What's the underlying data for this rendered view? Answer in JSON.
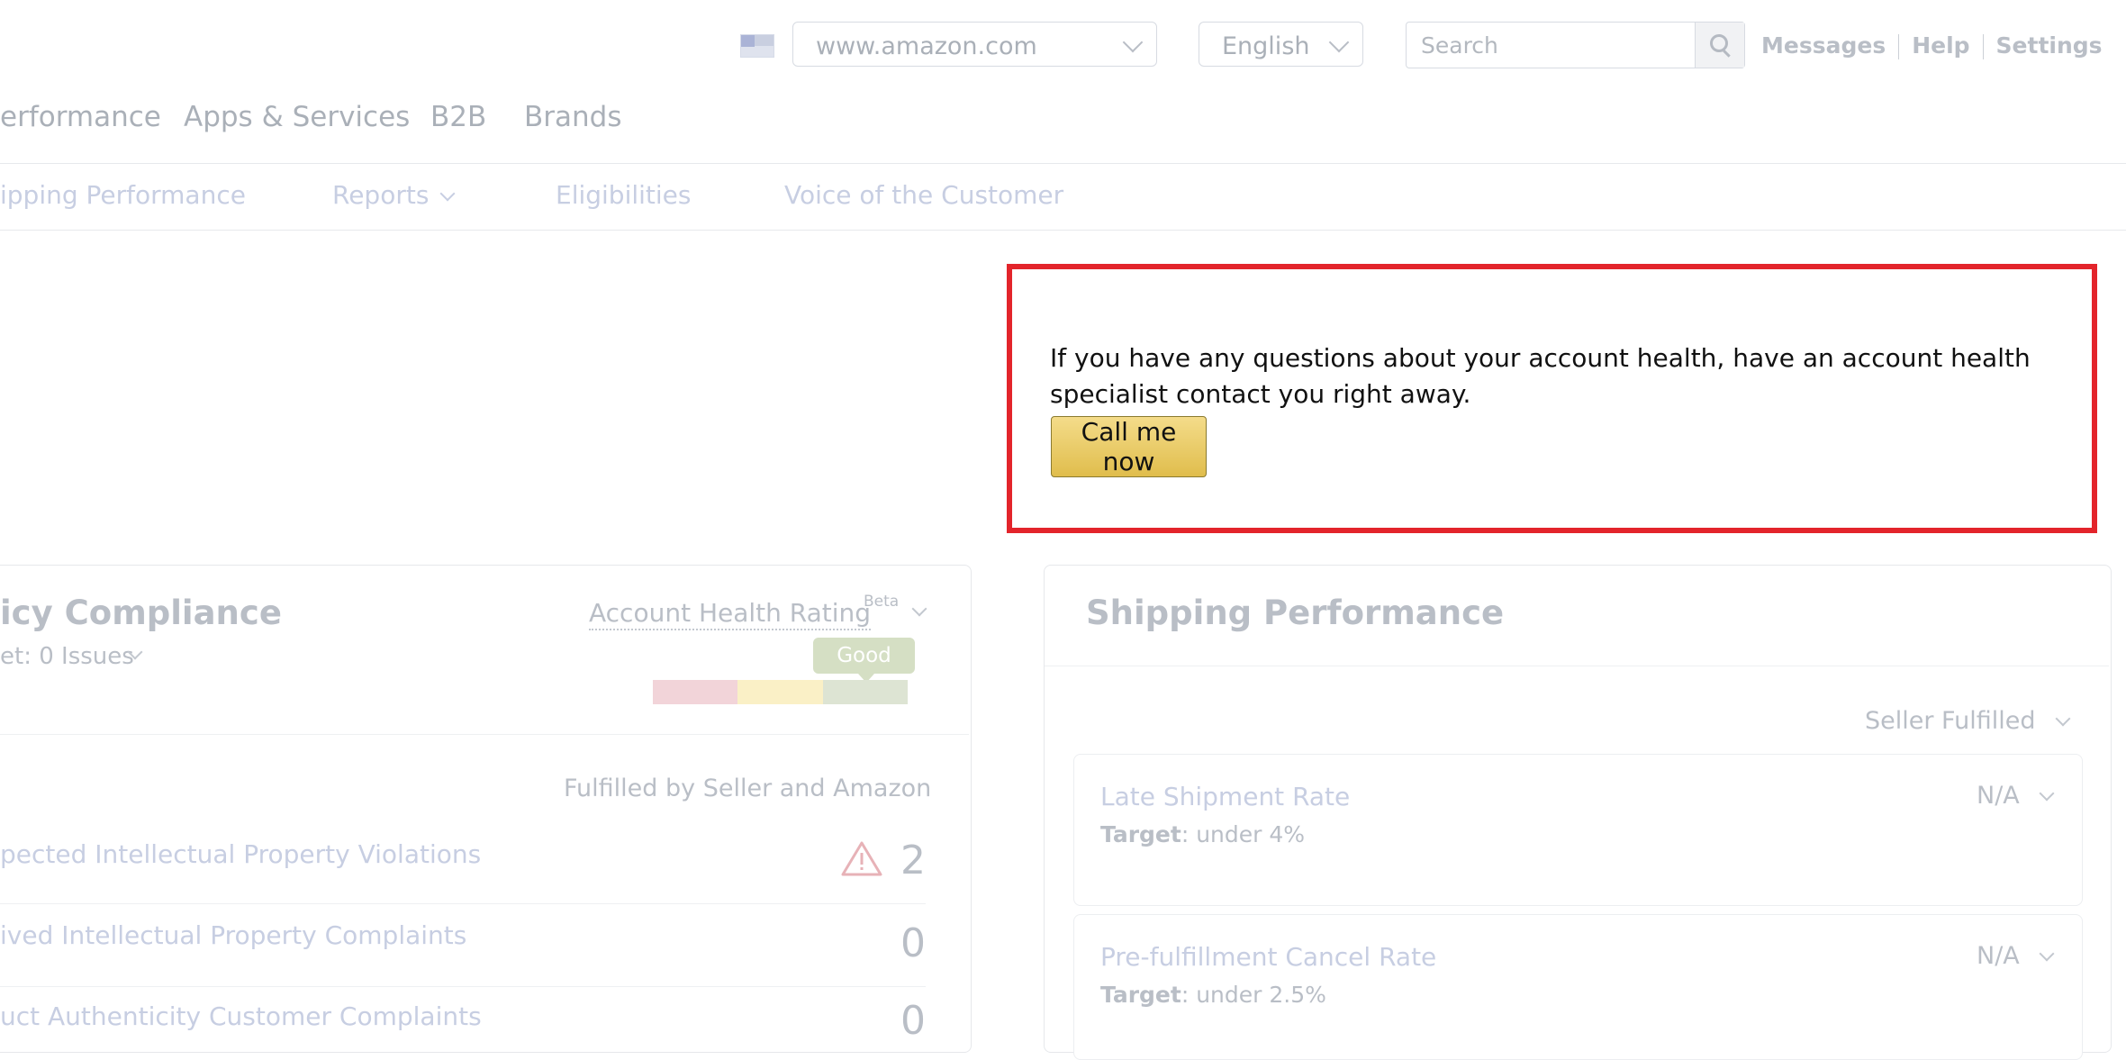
{
  "topbar": {
    "flag_icon": "us-flag-icon",
    "marketplace": "www.amazon.com",
    "language": "English",
    "search_placeholder": "Search",
    "links": [
      "Messages",
      "Help",
      "Settings"
    ]
  },
  "main_nav": [
    "erformance",
    "Apps & Services",
    "B2B",
    "Brands"
  ],
  "sub_nav": {
    "items": [
      "ipping Performance",
      "Reports",
      "Eligibilities",
      "Voice of the Customer"
    ]
  },
  "callout": {
    "message": "If you have any questions about your account health, have an account health specialist contact you right away.",
    "button": "Call me now",
    "border_color": "#e3242b"
  },
  "policy_card": {
    "title": "icy Compliance",
    "target": "et: 0 Issues",
    "rating_label": "Account Health Rating",
    "beta": "Beta",
    "rating_value": "Good",
    "fulfilled_label": "Fulfilled by Seller and Amazon",
    "rows": [
      {
        "label": "pected Intellectual Property Violations",
        "value": "2",
        "warning": true
      },
      {
        "label": "ived Intellectual Property Complaints",
        "value": "0",
        "warning": false
      },
      {
        "label": "uct Authenticity Customer Complaints",
        "value": "0",
        "warning": false
      }
    ]
  },
  "shipping_card": {
    "title": "Shipping Performance",
    "filter": "Seller Fulfilled",
    "metrics": [
      {
        "name": "Late Shipment Rate",
        "value": "N/A",
        "target_label": "Target",
        "target": ": under 4%"
      },
      {
        "name": "Pre-fulfillment Cancel Rate",
        "value": "N/A",
        "target_label": "Target",
        "target": ": under 2.5%"
      }
    ]
  }
}
